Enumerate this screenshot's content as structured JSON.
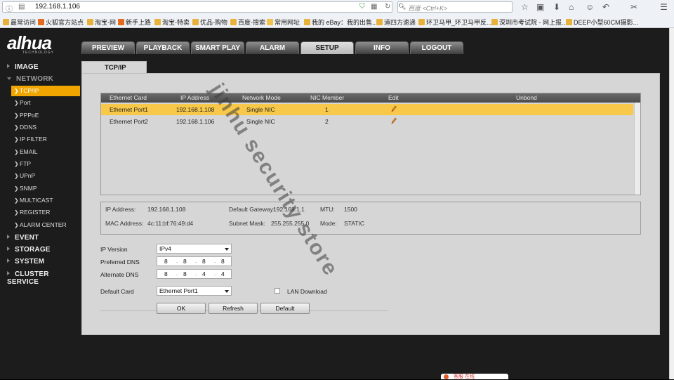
{
  "browser": {
    "url": "192.168.1.106",
    "search_placeholder": "百度 <Ctrl+K>",
    "bookmarks": [
      "最常访问",
      "火狐官方站点",
      "淘宝-网",
      "新手上路",
      "淘宝-特卖",
      "优品-购物",
      "百度-搜索",
      "常用网址",
      "我的 eBay：我的出售...",
      "道四方速递",
      "环卫马甲_环卫马甲反...",
      "深圳市考试院 - 网上报...",
      "DEEP小型60CM摄影..."
    ]
  },
  "logo": {
    "text": "alhua",
    "tagline": "TECHNOLOGY"
  },
  "nav": {
    "tabs": [
      "PREVIEW",
      "PLAYBACK",
      "SMART PLAY",
      "ALARM",
      "SETUP",
      "INFO",
      "LOGOUT"
    ],
    "active": "SETUP"
  },
  "sidebar": {
    "groups_top": [
      "IMAGE",
      "NETWORK"
    ],
    "network_items": [
      "TCP/IP",
      "Port",
      "PPPoE",
      "DDNS",
      "IP FILTER",
      "EMAIL",
      "FTP",
      "UPnP",
      "SNMP",
      "MULTICAST",
      "REGISTER",
      "ALARM CENTER"
    ],
    "groups_bottom": [
      "EVENT",
      "STORAGE",
      "SYSTEM",
      "CLUSTER SERVICE"
    ],
    "active_item": "TCP/IP"
  },
  "panel": {
    "tab": "TCP/IP",
    "table": {
      "headers": [
        "Ethernet Card",
        "IP Address",
        "Network Mode",
        "NIC Member",
        "Edit",
        "Unbond"
      ],
      "rows": [
        {
          "card": "Ethernet Port1",
          "ip": "192.168.1.108",
          "mode": "Single NIC",
          "member": "1"
        },
        {
          "card": "Ethernet Port2",
          "ip": "192.168.1.106",
          "mode": "Single NIC",
          "member": "2"
        }
      ]
    },
    "info": {
      "ip_label": "IP Address:",
      "ip": "192.168.1.108",
      "gw_label": "Default Gateway:",
      "gw": "192.168.1.1",
      "mtu_label": "MTU:",
      "mtu": "1500",
      "mac_label": "MAC Address:",
      "mac": "4c:11:bf:76:49:d4",
      "mask_label": "Subnet Mask:",
      "mask": "255.255.255.0",
      "mode_label": "Mode:",
      "mode": "STATIC"
    },
    "form": {
      "ip_version_label": "IP Version",
      "ip_version": "IPv4",
      "pref_dns_label": "Preferred DNS",
      "pref_dns": [
        "8",
        "8",
        "8",
        "8"
      ],
      "alt_dns_label": "Alternate DNS",
      "alt_dns": [
        "8",
        "8",
        "4",
        "4"
      ],
      "default_card_label": "Default Card",
      "default_card": "Ethernet Port1",
      "lan_download_label": "LAN Download"
    },
    "buttons": {
      "ok": "OK",
      "refresh": "Refresh",
      "default": "Default"
    }
  },
  "watermark": "jinhu security store",
  "chat_widget": "客服 在线"
}
